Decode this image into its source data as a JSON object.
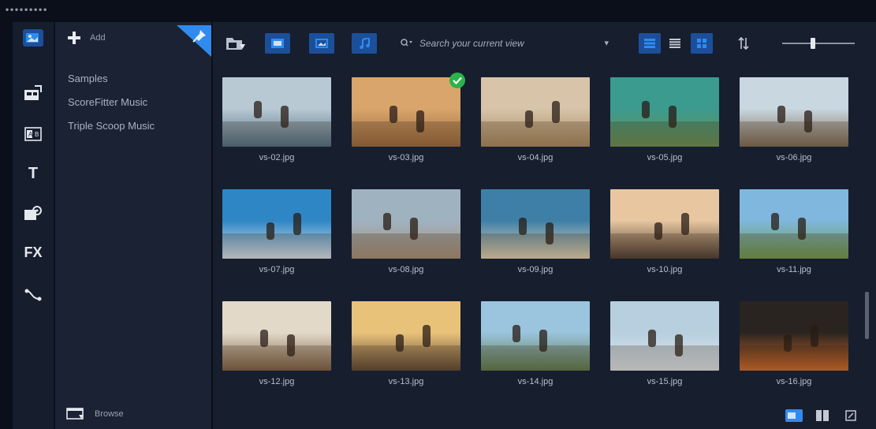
{
  "window": {
    "grip": "•••••••••"
  },
  "rail": {
    "items": [
      {
        "name": "media-library-icon",
        "label": ""
      },
      {
        "name": "instant-project-icon",
        "label": ""
      },
      {
        "name": "transition-icon",
        "label": ""
      },
      {
        "name": "title-icon",
        "label": "T"
      },
      {
        "name": "graphics-icon",
        "label": ""
      },
      {
        "name": "filter-icon",
        "label": "FX"
      },
      {
        "name": "path-icon",
        "label": ""
      }
    ]
  },
  "library": {
    "add_label": "Add",
    "items": [
      {
        "label": "Samples",
        "active": true
      },
      {
        "label": "ScoreFitter Music",
        "active": false
      },
      {
        "label": "Triple Scoop Music",
        "active": false
      }
    ],
    "browse_label": "Browse"
  },
  "toolbar": {
    "search": {
      "placeholder": "Search your current view",
      "caret": "▾"
    },
    "zoom_level": 0.42
  },
  "media": {
    "items": [
      {
        "name": "vs-02.jpg",
        "sky": "#b9c9d4",
        "ground": "#4f6f86",
        "checked": false
      },
      {
        "name": "vs-03.jpg",
        "sky": "#d9a56c",
        "ground": "#9a6a3e",
        "checked": true
      },
      {
        "name": "vs-04.jpg",
        "sky": "#d7c4a9",
        "ground": "#a98a5f",
        "checked": false
      },
      {
        "name": "vs-05.jpg",
        "sky": "#3a9b8e",
        "ground": "#6b8f52",
        "checked": false
      },
      {
        "name": "vs-06.jpg",
        "sky": "#c9d7e0",
        "ground": "#7d6a52",
        "checked": false
      },
      {
        "name": "vs-07.jpg",
        "sky": "#2f86c4",
        "ground": "#dbe8f1",
        "checked": false
      },
      {
        "name": "vs-08.jpg",
        "sky": "#9fb2c0",
        "ground": "#a9917a",
        "checked": false
      },
      {
        "name": "vs-09.jpg",
        "sky": "#3e7fa8",
        "ground": "#e7d6b4",
        "checked": false
      },
      {
        "name": "vs-10.jpg",
        "sky": "#e8c7a0",
        "ground": "#4a3a32",
        "checked": false
      },
      {
        "name": "vs-11.jpg",
        "sky": "#7fb7de",
        "ground": "#6f9b4a",
        "checked": false
      },
      {
        "name": "vs-12.jpg",
        "sky": "#e2d9c8",
        "ground": "#7d6046",
        "checked": false
      },
      {
        "name": "vs-13.jpg",
        "sky": "#e9c27a",
        "ground": "#5c4634",
        "checked": false
      },
      {
        "name": "vs-14.jpg",
        "sky": "#9bc4de",
        "ground": "#5d7b4b",
        "checked": false
      },
      {
        "name": "vs-15.jpg",
        "sky": "#b7cfdf",
        "ground": "#e2e8ee",
        "checked": false
      },
      {
        "name": "vs-16.jpg",
        "sky": "#2a2420",
        "ground": "#d26a2a",
        "checked": false
      }
    ]
  },
  "colors": {
    "accent": "#2f8bf0",
    "toolbar_button": "#1c4f9a",
    "check": "#2bb34a"
  }
}
